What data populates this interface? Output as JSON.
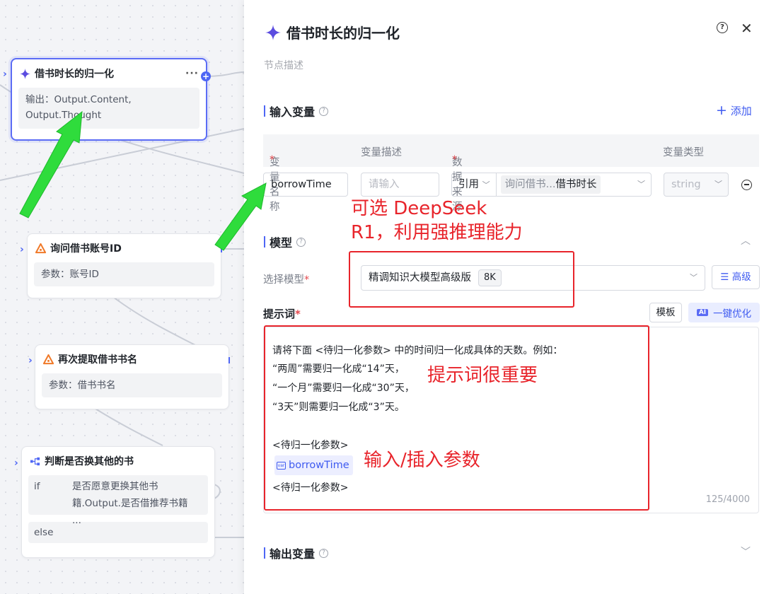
{
  "canvas": {
    "nodes": [
      {
        "title": "借书时长的归一化",
        "more": "···",
        "body": "输出：Output.Content, Output.Thought"
      },
      {
        "title": "询问借书账号ID",
        "body": "参数：账号ID"
      },
      {
        "title": "再次提取借书书名",
        "body": "参数：借书书名"
      },
      {
        "title": "判断是否换其他的书",
        "if_label": "if",
        "if_text": "是否愿意更换其他书籍.Output.是否借推荐书籍 ...",
        "else_label": "else"
      }
    ]
  },
  "panel": {
    "title": "借书时长的归一化",
    "description_placeholder": "节点描述",
    "input_section": {
      "title": "输入变量",
      "add_label": "添加",
      "columns": {
        "name": "变量名称",
        "desc": "变量描述",
        "source": "数据来源",
        "type": "变量类型"
      },
      "row": {
        "name": "borrowTime",
        "desc_placeholder": "请输入",
        "source_mode": "引用",
        "source_path": "询问借书...",
        "source_value": "借书时长",
        "type": "string"
      }
    },
    "model_section": {
      "title": "模型",
      "select_label": "选择模型",
      "model_name": "精调知识大模型高级版",
      "model_context": "8K",
      "advanced_label": "高级"
    },
    "prompt_section": {
      "title": "提示词",
      "template_btn": "模板",
      "optimize_btn": "一键优化",
      "ai_badge": "AI",
      "lines": [
        "请将下面 <待归一化参数> 中的时间归一化成具体的天数。例如：",
        "“两周”需要归一化成“14”天，",
        "“一个月”需要归一化成“30”天，",
        "“3天”则需要归一化成“3”天。",
        "<待归一化参数>",
        "<待归一化参数>"
      ],
      "variable_chip": "borrowTime",
      "counter": "125/4000"
    },
    "output_section": {
      "title": "输出变量"
    }
  },
  "annotations": {
    "model_note": [
      "可选 DeepSeek",
      "R1，利用强推理能力"
    ],
    "prompt_note": "提示词很重要",
    "insert_note": "输入/插入参数"
  },
  "colors": {
    "accent": "#4e66f5",
    "annotation_red": "#e8242b",
    "arrow_green": "#2fdc3c"
  }
}
